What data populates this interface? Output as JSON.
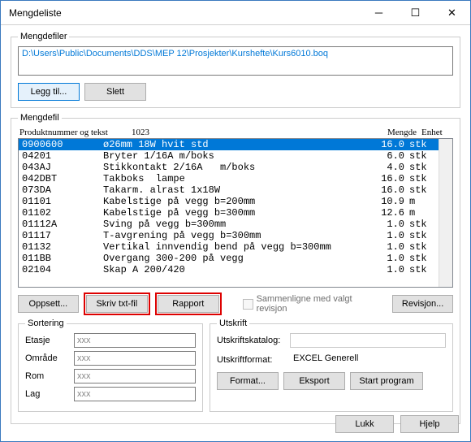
{
  "window": {
    "title": "Mengdeliste"
  },
  "filer": {
    "legend": "Mengdefiler",
    "path": "D:\\Users\\Public\\Documents\\DDS\\MEP 12\\Prosjekter\\Kurshefte\\Kurs6010.boq",
    "add": "Legg til...",
    "del": "Slett"
  },
  "list": {
    "legend": "Mengdefil",
    "headers": {
      "prod": "Produktnummer og tekst",
      "mid": "1023",
      "qty": "Mengde",
      "unit": "Enhet"
    },
    "rows": [
      {
        "prod": "0900600",
        "text": "ø26mm 18W hvit std",
        "qty": "16.0",
        "unit": "stk",
        "sel": true
      },
      {
        "prod": "04201",
        "text": "Bryter 1/16A m/boks",
        "qty": "6.0",
        "unit": "stk"
      },
      {
        "prod": "043AJ",
        "text": "Stikkontakt 2/16A   m/boks",
        "qty": "4.0",
        "unit": "stk"
      },
      {
        "prod": "042DBT",
        "text": "Takboks  lampe",
        "qty": "16.0",
        "unit": "stk"
      },
      {
        "prod": "073DA",
        "text": "Takarm. alrast 1x18W",
        "qty": "16.0",
        "unit": "stk"
      },
      {
        "prod": "01101",
        "text": "Kabelstige på vegg b=200mm",
        "qty": "10.9",
        "unit": "m"
      },
      {
        "prod": "01102",
        "text": "Kabelstige på vegg b=300mm",
        "qty": "12.6",
        "unit": "m"
      },
      {
        "prod": "01112A",
        "text": "Sving på vegg b=300mm",
        "qty": "1.0",
        "unit": "stk"
      },
      {
        "prod": "01117",
        "text": "T-avgrening på vegg b=300mm",
        "qty": "1.0",
        "unit": "stk"
      },
      {
        "prod": "01132",
        "text": "Vertikal innvendig bend på vegg b=300mm",
        "qty": "1.0",
        "unit": "stk"
      },
      {
        "prod": "011BB",
        "text": "Overgang 300-200 på vegg",
        "qty": "1.0",
        "unit": "stk"
      },
      {
        "prod": "02104",
        "text": "Skap A 200/420",
        "qty": "1.0",
        "unit": "stk"
      }
    ]
  },
  "actions": {
    "oppsett": "Oppsett...",
    "skriv": "Skriv txt-fil",
    "rapport": "Rapport",
    "compare": "Sammenligne med valgt revisjon",
    "revisjon": "Revisjon..."
  },
  "sortering": {
    "legend": "Sortering",
    "placeholder": "xxx",
    "labels": {
      "etasje": "Etasje",
      "omrade": "Område",
      "rom": "Rom",
      "lag": "Lag"
    }
  },
  "utskrift": {
    "legend": "Utskrift",
    "katalog_label": "Utskriftskatalog:",
    "katalog": "",
    "format_label": "Utskriftformat:",
    "format": "EXCEL Generell",
    "btn_format": "Format...",
    "btn_eksport": "Eksport",
    "btn_start": "Start program"
  },
  "footer": {
    "lukk": "Lukk",
    "hjelp": "Hjelp"
  }
}
